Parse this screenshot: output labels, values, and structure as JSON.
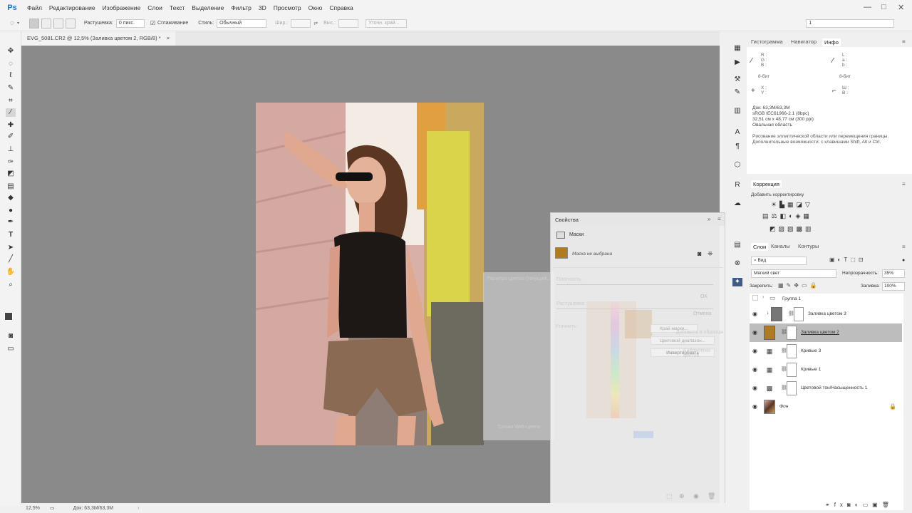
{
  "app": {
    "logo": "Ps"
  },
  "menu": [
    "Файл",
    "Редактирование",
    "Изображение",
    "Слои",
    "Текст",
    "Выделение",
    "Фильтр",
    "3D",
    "Просмотр",
    "Окно",
    "Справка"
  ],
  "window_controls": {
    "minimize": "—",
    "maximize": "□",
    "close": "✕"
  },
  "options": {
    "feather_label": "Растушевка:",
    "feather_value": "0 пикс.",
    "antialias_label": "Сглаживание",
    "style_label": "Стиль:",
    "style_value": "Обычный",
    "width_label": "Шир.:",
    "height_label": "Выс.:",
    "refine_label": "Уточн. край...",
    "workspace_value": "1"
  },
  "document_tab": {
    "title": "EVG_5081.CR2 @ 12,5% (Заливка цветом 2, RGB/8) *",
    "close": "×"
  },
  "status": {
    "zoom": "12,5%",
    "doc": "Док: 63,3M/63,3M"
  },
  "info_panel": {
    "tabs": [
      "Гистограмма",
      "Навигатор",
      "Инфо"
    ],
    "rgb_labels": [
      "R :",
      "G :",
      "B :"
    ],
    "lab_labels": [
      "L :",
      "a :",
      "b :"
    ],
    "bit_left": "8-бит",
    "bit_right": "8-бит",
    "xy_labels": [
      "X :",
      "Y :"
    ],
    "wh_labels": [
      "Ш :",
      "В :"
    ],
    "doc_info": [
      "Док: 63,3M/63,3M",
      "sRGB IEC61966-2.1 (8bpc)",
      "32,51 см x 48,77 см (300 ppi)",
      "Овальная область"
    ],
    "hint": "Рисование эллиптической области или перемещения границы. Дополнительные возможности: с клавишами Shift, Alt и Ctrl."
  },
  "correction_panel": {
    "title": "Коррекция",
    "subtitle": "Добавить корректировку"
  },
  "layers_panel": {
    "tabs": [
      "Слои",
      "Каналы",
      "Контуры"
    ],
    "filter_value": "Вид",
    "blend_mode": "Мягкий свет",
    "opacity_label": "Непрозрачность:",
    "opacity_value": "35%",
    "lock_label": "Закрепить:",
    "fill_label": "Заливка:",
    "fill_value": "100%",
    "layers": [
      {
        "name": "Группа 1"
      },
      {
        "name": "Заливка цветом 3"
      },
      {
        "name": "Заливка цветом 2"
      },
      {
        "name": "Кривые 3"
      },
      {
        "name": "Кривые 1"
      },
      {
        "name": "Цветовой тон/Насыщенность 1"
      },
      {
        "name": "Фон"
      }
    ]
  },
  "properties_panel": {
    "title": "Свойства",
    "masks_label": "Маски",
    "mask_state": "Маска не выбрана",
    "density_label": "Плотность:",
    "feather_label": "Растушевка:",
    "refine_label": "Уточнить:",
    "mask_edge_btn": "Край маски...",
    "color_range_btn": "Цветовой диапазон...",
    "invert_btn": "Инвертировать"
  },
  "ghost_picker": {
    "title": "Палитра цветов (текущий...)",
    "ok": "OK",
    "cancel": "Отмена",
    "add_swatch": "Добавить в образцы",
    "libraries": "Библиотеки цветов",
    "web_only": "Только Web-цвета"
  },
  "colors": {
    "accent": "#1473e6",
    "canvas": "#8a8a8a",
    "fill_swatch": "#b07a1f",
    "selected_layer": "#bdbdbd"
  }
}
